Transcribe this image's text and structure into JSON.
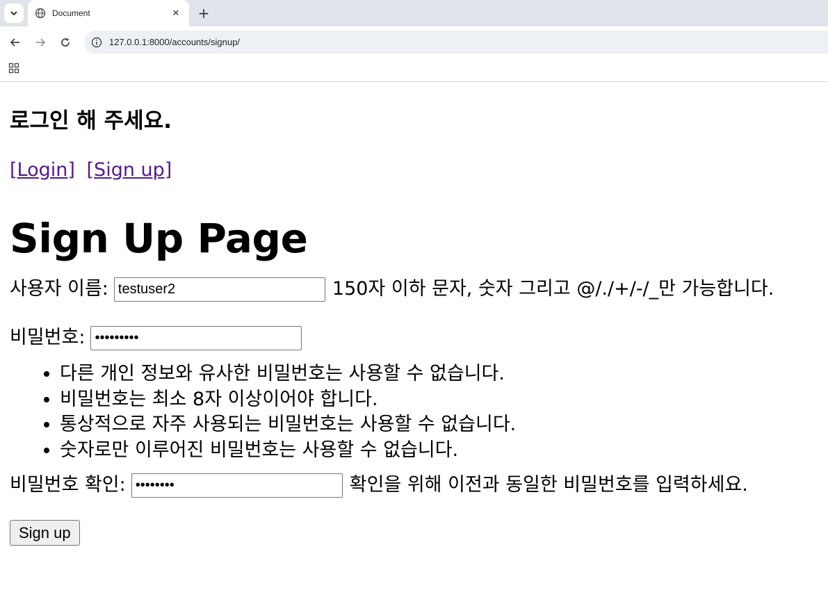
{
  "browser": {
    "tab_title": "Document",
    "url": "127.0.0.1:8000/accounts/signup/"
  },
  "page": {
    "greeting": "로그인 해 주세요.",
    "login_link": "[Login]",
    "signup_link": "[Sign up]",
    "title": "Sign Up Page"
  },
  "form": {
    "username": {
      "label": "사용자 이름:",
      "value": "testuser2",
      "help": "150자 이하 문자, 숫자 그리고 @/./+/-/_만 가능합니다."
    },
    "password1": {
      "label": "비밀번호:",
      "value": "password1"
    },
    "password_rules": [
      "다른 개인 정보와 유사한 비밀번호는 사용할 수 없습니다.",
      "비밀번호는 최소 8자 이상이어야 합니다.",
      "통상적으로 자주 사용되는 비밀번호는 사용할 수 없습니다.",
      "숫자로만 이루어진 비밀번호는 사용할 수 없습니다."
    ],
    "password2": {
      "label": "비밀번호 확인:",
      "value": "password",
      "help": "확인을 위해 이전과 동일한 비밀번호를 입력하세요."
    },
    "submit_label": "Sign up"
  },
  "colors": {
    "link_visited": "#551a8b",
    "tabstrip_bg": "#dfe3ea",
    "omnibox_bg": "#edf0f5"
  }
}
